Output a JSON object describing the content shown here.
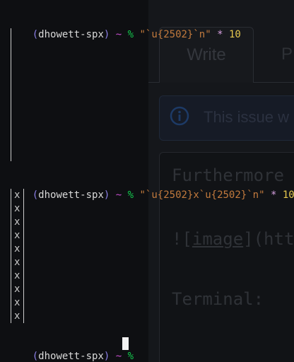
{
  "background_page": {
    "tab_write": "Write",
    "tab_preview": "P",
    "banner_text": "This issue w",
    "editor_lines": [
      "Furthermore",
      "![image](htt",
      "Terminal:"
    ],
    "editor_link_text": "image"
  },
  "terminal": {
    "prompt": {
      "open_paren": "(",
      "user": "dhowett-spx",
      "close_paren": ")",
      "dir": "~",
      "symbol": "%"
    },
    "commands": [
      {
        "string": "\"`u{2502}`n\"",
        "operator": "*",
        "count": "10"
      },
      {
        "string": "\"`u{2502}x`u{2502}`n\"",
        "operator": "*",
        "count": "10"
      }
    ],
    "output2_char": "x",
    "output2_rows": 10
  },
  "colors": {
    "paren": "#8b7fe6",
    "tilde": "#c54dcc",
    "percent": "#13c64d",
    "string": "#c27a3d",
    "number": "#e6c84e"
  }
}
